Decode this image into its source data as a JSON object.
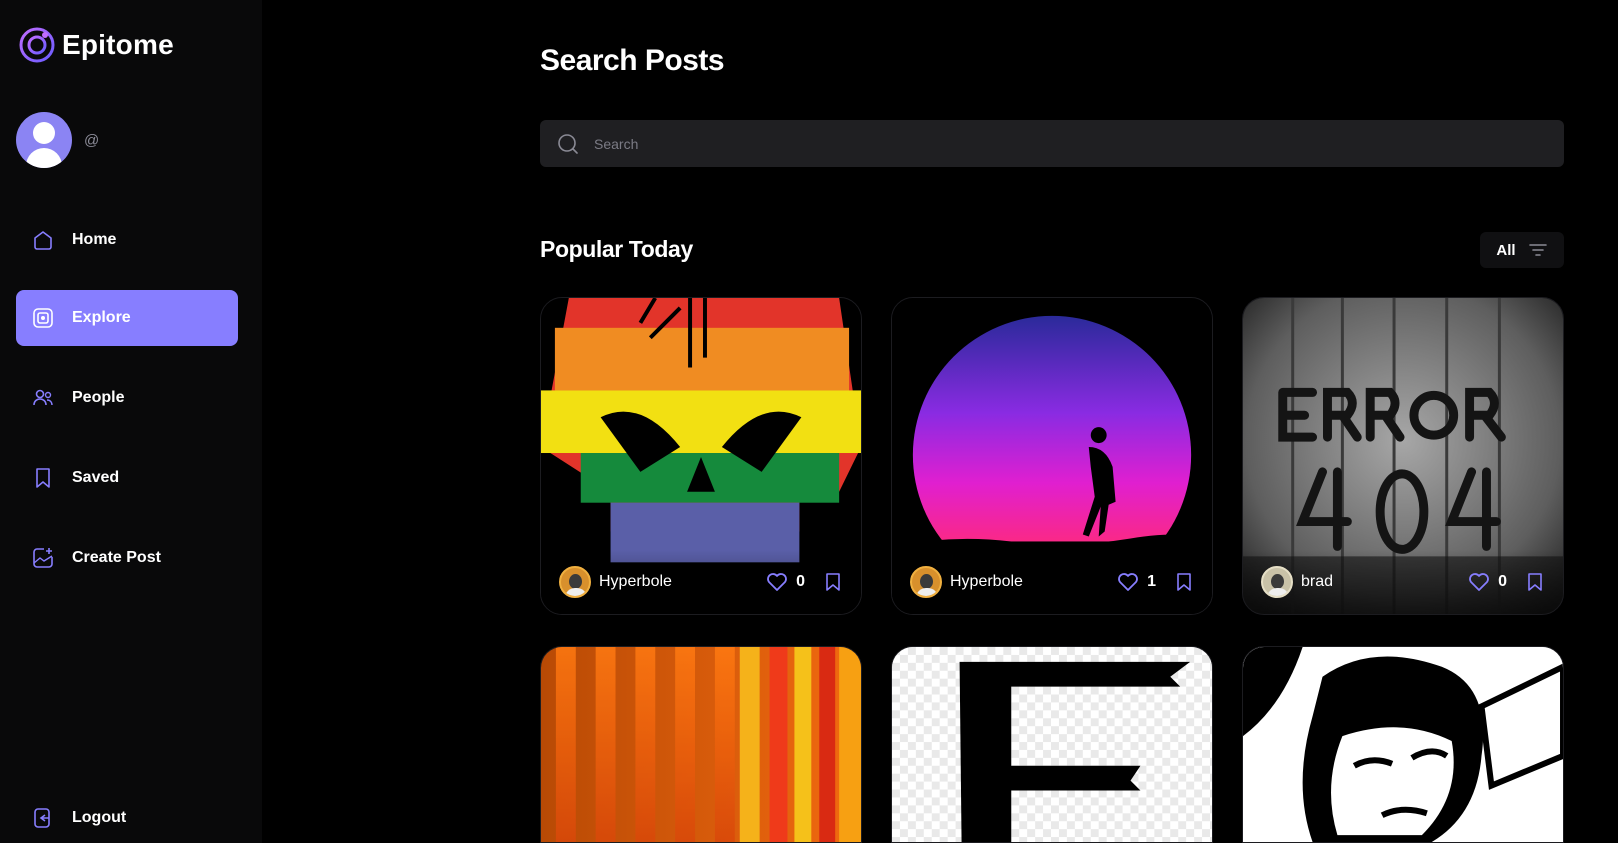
{
  "app": {
    "name": "Epitome"
  },
  "profile": {
    "handle": "@"
  },
  "nav": [
    {
      "label": "Home",
      "icon": "home-icon",
      "active": false
    },
    {
      "label": "Explore",
      "icon": "explore-icon",
      "active": true
    },
    {
      "label": "People",
      "icon": "people-icon",
      "active": false
    },
    {
      "label": "Saved",
      "icon": "bookmark-icon",
      "active": false
    },
    {
      "label": "Create Post",
      "icon": "create-post-icon",
      "active": false
    }
  ],
  "logout": {
    "label": "Logout"
  },
  "page": {
    "title": "Search Posts"
  },
  "search": {
    "placeholder": "Search",
    "value": ""
  },
  "section": {
    "title": "Popular Today",
    "filter_label": "All"
  },
  "posts": [
    {
      "creator": "Hyperbole",
      "likes": "0",
      "image": "rainbow-skull"
    },
    {
      "creator": "Hyperbole",
      "likes": "1",
      "image": "sunset-silhouette"
    },
    {
      "creator": "brad",
      "likes": "0",
      "image": "error-404-wall"
    },
    {
      "creator": "",
      "likes": "",
      "image": "orange-stripes"
    },
    {
      "creator": "",
      "likes": "",
      "image": "brush-letter"
    },
    {
      "creator": "",
      "likes": "",
      "image": "bw-portrait"
    }
  ],
  "colors": {
    "accent": "#877eff",
    "background": "#000000",
    "sidebar": "#09090a",
    "input": "#1f1f22"
  }
}
